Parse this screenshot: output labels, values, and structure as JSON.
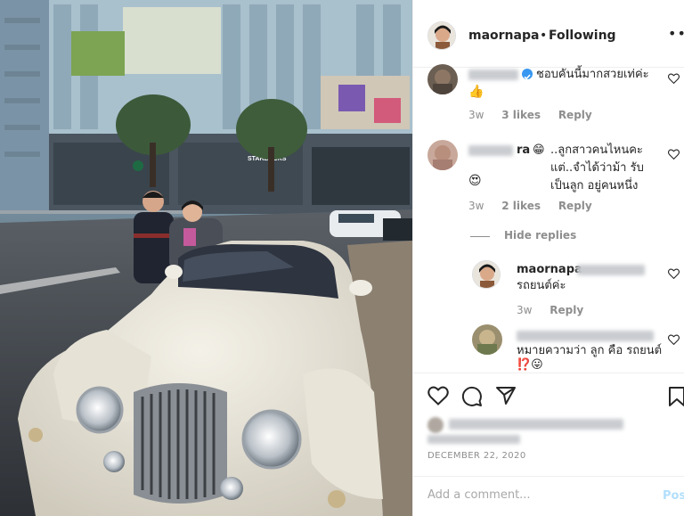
{
  "post": {
    "author": "maornapa",
    "follow_status": "Following",
    "dot": "•",
    "more": "•••",
    "date": "DECEMBER 22, 2020"
  },
  "comments": [
    {
      "text": "ชอบคันนี้มากสวยเท่ค่ะ",
      "emoji": "👍",
      "time": "3w",
      "likes": "3 likes",
      "reply": "Reply",
      "verified": true
    },
    {
      "name_suffix": "ra",
      "emoji_lead": "😁",
      "text": "..ลูกสาวคนไหนคะ แต่..จำได้ว่าม้า รับเป็นลูก อยู่คนหนึ่ง",
      "emoji": "😍",
      "time": "3w",
      "likes": "2 likes",
      "reply": "Reply"
    }
  ],
  "hide_replies": "Hide replies",
  "replies": [
    {
      "author": "maornapa",
      "text": "รถยนต์ค่ะ",
      "time": "3w",
      "reply": "Reply"
    },
    {
      "text": "หมายความว่า ลูก คือ รถยนต์",
      "emoji": "⁉️😛"
    }
  ],
  "add_comment": {
    "placeholder": "Add a comment...",
    "post_label": "Post"
  },
  "photo": {
    "store_sign": "STARBUCKS"
  },
  "colors": {
    "verified": "#3897f0",
    "post_disabled": "#b2dffc",
    "meta_gray": "#8e8e8e",
    "text": "#262626"
  }
}
